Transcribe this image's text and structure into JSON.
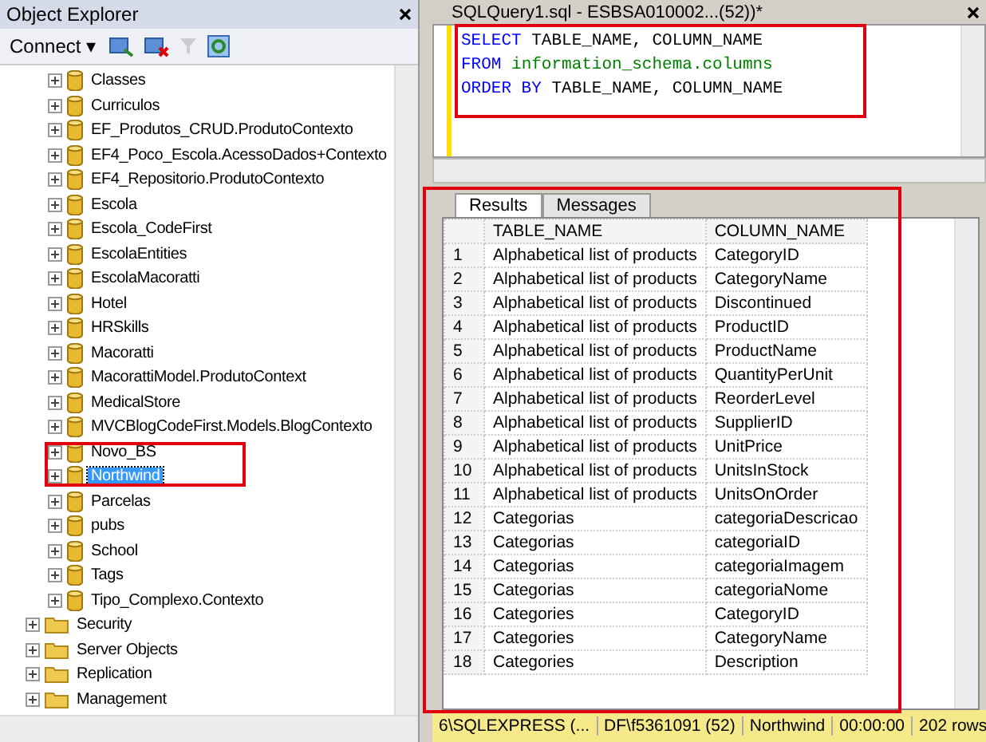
{
  "object_explorer": {
    "title": "Object Explorer",
    "toolbar": {
      "connect": "Connect",
      "connect_caret": "▾"
    },
    "databases": [
      {
        "label": "Classes",
        "selected": false
      },
      {
        "label": "Curriculos",
        "selected": false
      },
      {
        "label": "EF_Produtos_CRUD.ProdutoContexto",
        "selected": false
      },
      {
        "label": "EF4_Poco_Escola.AcessoDados+Contexto",
        "selected": false
      },
      {
        "label": "EF4_Repositorio.ProdutoContexto",
        "selected": false
      },
      {
        "label": "Escola",
        "selected": false
      },
      {
        "label": "Escola_CodeFirst",
        "selected": false
      },
      {
        "label": "EscolaEntities",
        "selected": false
      },
      {
        "label": "EscolaMacoratti",
        "selected": false
      },
      {
        "label": "Hotel",
        "selected": false
      },
      {
        "label": "HRSkills",
        "selected": false
      },
      {
        "label": "Macoratti",
        "selected": false
      },
      {
        "label": "MacorattiModel.ProdutoContext",
        "selected": false
      },
      {
        "label": "MedicalStore",
        "selected": false
      },
      {
        "label": "MVCBlogCodeFirst.Models.BlogContexto",
        "selected": false
      },
      {
        "label": "Novo_BS",
        "selected": false
      },
      {
        "label": "Northwind",
        "selected": true
      },
      {
        "label": "Parcelas",
        "selected": false
      },
      {
        "label": "pubs",
        "selected": false
      },
      {
        "label": "School",
        "selected": false
      },
      {
        "label": "Tags",
        "selected": false
      },
      {
        "label": "Tipo_Complexo.Contexto",
        "selected": false
      }
    ],
    "folders": [
      {
        "label": "Security",
        "selected": false
      },
      {
        "label": "Server Objects",
        "selected": false
      },
      {
        "label": "Replication",
        "selected": false
      },
      {
        "label": "Management",
        "selected": false
      }
    ]
  },
  "editor": {
    "tab_title": "SQLQuery1.sql - ESBSA010002...(52))*",
    "lines": [
      [
        {
          "kind": "keyword",
          "text": "SELECT"
        },
        {
          "kind": "plain",
          "text": " TABLE_NAME, COLUMN_NAME"
        }
      ],
      [
        {
          "kind": "keyword",
          "text": "FROM"
        },
        {
          "kind": "system",
          "text": " information_schema.columns"
        }
      ],
      [
        {
          "kind": "keyword",
          "text": "ORDER BY"
        },
        {
          "kind": "plain",
          "text": " TABLE_NAME, COLUMN_NAME"
        }
      ]
    ]
  },
  "result_tabs": [
    {
      "label": "Results",
      "selected": true
    },
    {
      "label": "Messages",
      "selected": false
    }
  ],
  "table": {
    "columns": [
      "",
      "TABLE_NAME",
      "COLUMN_NAME"
    ],
    "rows": [
      [
        "1",
        "Alphabetical list of products",
        "CategoryID"
      ],
      [
        "2",
        "Alphabetical list of products",
        "CategoryName"
      ],
      [
        "3",
        "Alphabetical list of products",
        "Discontinued"
      ],
      [
        "4",
        "Alphabetical list of products",
        "ProductID"
      ],
      [
        "5",
        "Alphabetical list of products",
        "ProductName"
      ],
      [
        "6",
        "Alphabetical list of products",
        "QuantityPerUnit"
      ],
      [
        "7",
        "Alphabetical list of products",
        "ReorderLevel"
      ],
      [
        "8",
        "Alphabetical list of products",
        "SupplierID"
      ],
      [
        "9",
        "Alphabetical list of products",
        "UnitPrice"
      ],
      [
        "10",
        "Alphabetical list of products",
        "UnitsInStock"
      ],
      [
        "11",
        "Alphabetical list of products",
        "UnitsOnOrder"
      ],
      [
        "12",
        "Categorias",
        "categoriaDescricao"
      ],
      [
        "13",
        "Categorias",
        "categoriaID"
      ],
      [
        "14",
        "Categorias",
        "categoriaImagem"
      ],
      [
        "15",
        "Categorias",
        "categoriaNome"
      ],
      [
        "16",
        "Categories",
        "CategoryID"
      ],
      [
        "17",
        "Categories",
        "CategoryName"
      ],
      [
        "18",
        "Categories",
        "Description"
      ]
    ]
  },
  "status_bar": [
    "6\\SQLEXPRESS (...",
    "DF\\f5361091 (52)",
    "Northwind",
    "00:00:00",
    "202 rows"
  ]
}
